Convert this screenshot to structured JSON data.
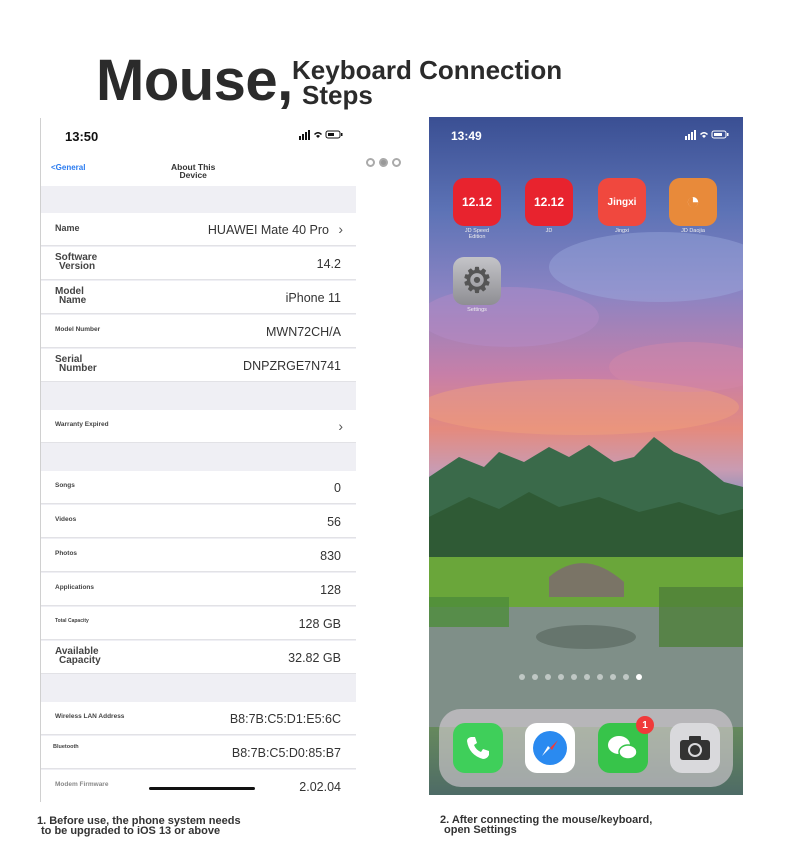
{
  "header": {
    "title_big": "Mouse,",
    "title_line1": "Keyboard Connection",
    "title_line2": "Steps"
  },
  "left_phone": {
    "status_time": "13:50",
    "status_icons": "▐▐ ◥ ▭",
    "nav_back": "<General",
    "nav_title_line1": "About This",
    "nav_title_line2": "Device",
    "rows": [
      {
        "label": "Name",
        "value": "HUAWEI Mate 40 Pro",
        "chevron": "›"
      },
      {
        "label_line1": "Software",
        "label_line2": "Version",
        "value": "14.2"
      },
      {
        "label_line1": "Model",
        "label_line2": "Name",
        "value": "iPhone 11"
      },
      {
        "label": "Model Number",
        "value": "MWN72CH/A"
      },
      {
        "label_line1": "Serial",
        "label_line2": "Number",
        "value": "DNPZRGE7N741"
      },
      {
        "label": "Warranty Expired",
        "chevron": "›"
      },
      {
        "label": "Songs",
        "value": "0"
      },
      {
        "label": "Videos",
        "value": "56"
      },
      {
        "label": "Photos",
        "value": "830"
      },
      {
        "label": "Applications",
        "value": "128"
      },
      {
        "label": "Total Capacity",
        "value": "128 GB"
      },
      {
        "label_line1": "Available",
        "label_line2": "Capacity",
        "value": "32.82 GB"
      },
      {
        "label": "Wireless LAN Address",
        "value": "B8:7B:C5:D1:E5:6C"
      },
      {
        "label": "Bluetooth",
        "value": "B8:7B:C5:D0:85:B7"
      },
      {
        "label": "Modem Firmware",
        "value": "2.02.04"
      }
    ]
  },
  "right_phone": {
    "status_time": "13:49",
    "status_icons": "▐▐ ◥ ▭",
    "apps": [
      {
        "label_line1": "JD Speed",
        "label_line2": "Edition",
        "icon_text": "12.12",
        "color": "#e8232e"
      },
      {
        "label_line1": "JD",
        "label_line2": "",
        "icon_text": "12.12",
        "color": "#e8232e"
      },
      {
        "label_line1": "Jingxi",
        "label_line2": "",
        "icon_text": "Jingxi",
        "color": "#f0483e"
      },
      {
        "label_line1": "JD Daojia",
        "label_line2": "",
        "icon_text": "◔",
        "color": "#e88a3a"
      },
      {
        "label_line1": "Settings",
        "label_line2": "",
        "icon_text": "⚙",
        "color": "#8e8e93"
      }
    ],
    "dock_badge": "1"
  },
  "captions": {
    "left_line1": "1. Before use, the phone system needs",
    "left_line2": "to be upgraded to iOS 13 or above",
    "right_line1": "2. After connecting the mouse/keyboard,",
    "right_line2": "open Settings"
  }
}
